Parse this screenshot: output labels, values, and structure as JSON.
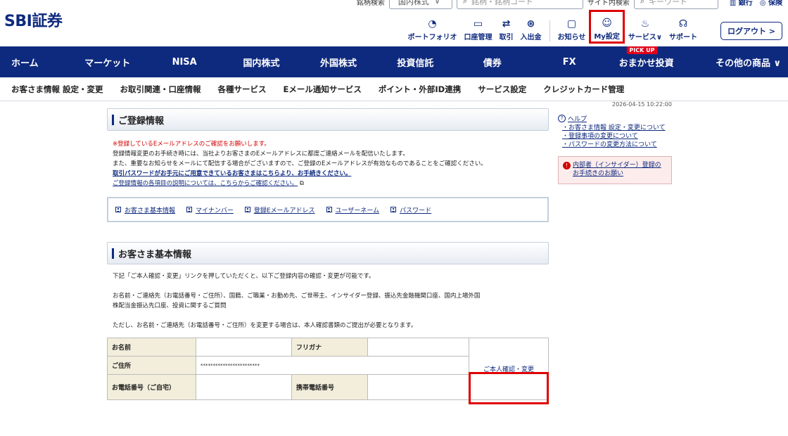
{
  "header": {
    "logo_prefix": "SBI",
    "logo_suffix": "証券",
    "search_label": "銘柄検索",
    "market_select": "国内株式",
    "stock_search_placeholder": "銘柄・銘柄コード",
    "site_search_label": "サイト内検索",
    "site_search_placeholder": "キーワード",
    "bank_link": "銀行",
    "insurance_link": "保険",
    "icons": [
      {
        "label": "ポートフォリオ",
        "icon": "portfolio-icon"
      },
      {
        "label": "口座管理",
        "icon": "account-icon"
      },
      {
        "label": "取引",
        "icon": "trade-icon"
      },
      {
        "label": "入出金",
        "icon": "money-icon"
      }
    ],
    "notice_label": "お知らせ",
    "mysettings_label": "My設定",
    "services_label": "サービス",
    "support_label": "サポート",
    "logout_label": "ログアウト >"
  },
  "mainnav": {
    "items": [
      "ホーム",
      "マーケット",
      "NISA",
      "国内株式",
      "外国株式",
      "投資信託",
      "債券",
      "FX",
      "おまかせ投資",
      "その他の商品 ∨"
    ],
    "pickup_badge": "PICK UP"
  },
  "subnav": {
    "items": [
      "お客さま情報 設定・変更",
      "お取引関連・口座情報",
      "各種サービス",
      "Eメール通知サービス",
      "ポイント・外部ID連携",
      "サービス設定",
      "クレジットカード管理"
    ]
  },
  "timestamp": "2026-04-15 10:22:00",
  "registration": {
    "title": "ご登録情報",
    "notice_red": "※登録しているEメールアドレスのご確認をお願いします。",
    "notice_1": "登録情報変更のお手続き時には、当社よりお客さまのEメールアドレスに都度ご連絡メールを配信いたします。",
    "notice_2": "また、重要なお知らせをメールにて配信する場合がございますので、ご登録のEメールアドレスが有効なものであることをご確認ください。",
    "password_link": "取引パスワードがお手元にご用意できているお客さまはこちらより、お手続きください。",
    "explain_link": "ご登録情報の各項目の説明については、こちらからご確認ください。",
    "anchors": [
      "お客さま基本情報",
      "マイナンバー",
      "登録Eメールアドレス",
      "ユーザーネーム",
      "パスワード"
    ]
  },
  "basic": {
    "title": "お客さま基本情報",
    "text_1": "下記「ご本人確認・変更」リンクを押していただくと、以下ご登録内容の確認・変更が可能です。",
    "text_2": "お名前・ご連絡先（お電話番号・ご住所）、国籍、ご職業・お勤め先、ご世帯主、インサイダー登録、振込先金融機関口座、国内上場外国",
    "text_3": "株配当金振込先口座、投資に関するご質問",
    "text_4": "ただし、お名前・ご連絡先（お電話番号・ご住所）を変更する場合は、本人確認書類のご提出が必要となります。",
    "table": {
      "name_label": "お名前",
      "name_value": "",
      "furigana_label": "フリガナ",
      "furigana_value": "",
      "address_label": "ご住所",
      "address_value": "************************",
      "phone_label": "お電話番号（ご自宅）",
      "phone_value": "",
      "mobile_label": "携帯電話番号",
      "mobile_value": "",
      "verify_link": "ご本人確認・変更"
    }
  },
  "side": {
    "help_label": "ヘルプ",
    "links": [
      "お客さま情報 設定・変更について",
      "登録事項の変更について",
      "パスワードの変更方法について"
    ],
    "insider_link": "内部者（インサイダー）登録のお手続きのお願い"
  }
}
